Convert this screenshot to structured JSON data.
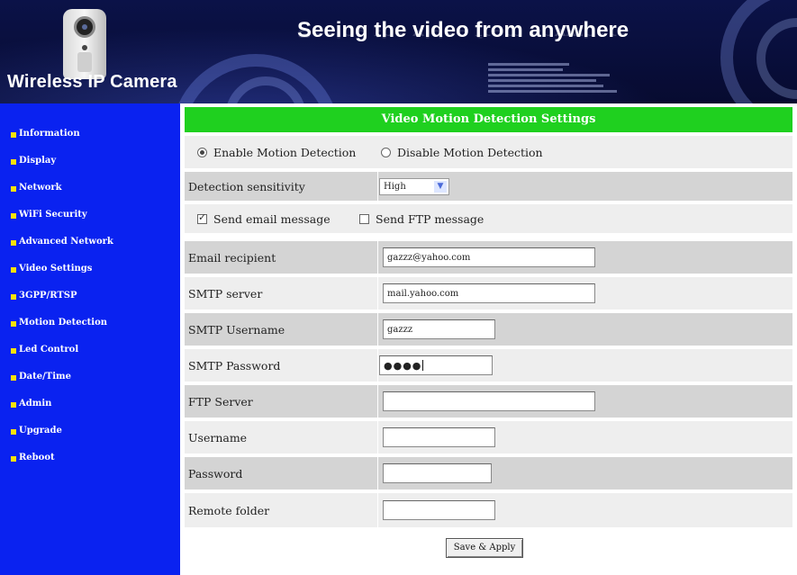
{
  "header": {
    "logo_text": "Wireless IP Camera",
    "slogan": "Seeing the video from anywhere"
  },
  "sidebar": {
    "items": [
      {
        "label": "Information"
      },
      {
        "label": "Display"
      },
      {
        "label": "Network"
      },
      {
        "label": "WiFi Security"
      },
      {
        "label": "Advanced Network"
      },
      {
        "label": "Video Settings"
      },
      {
        "label": "3GPP/RTSP"
      },
      {
        "label": "Motion Detection"
      },
      {
        "label": "Led Control"
      },
      {
        "label": "Date/Time"
      },
      {
        "label": "Admin"
      },
      {
        "label": "Upgrade"
      },
      {
        "label": "Reboot"
      }
    ]
  },
  "form": {
    "title": "Video Motion Detection Settings",
    "enable_label": "Enable Motion Detection",
    "disable_label": "Disable Motion Detection",
    "motion_enabled": true,
    "sensitivity_label": "Detection sensitivity",
    "sensitivity_value": "High",
    "send_email_label": "Send email message",
    "send_email_checked": true,
    "send_ftp_label": "Send FTP message",
    "send_ftp_checked": false,
    "email_recipient_label": "Email recipient",
    "email_recipient_value": "gazzz@yahoo.com",
    "smtp_server_label": "SMTP server",
    "smtp_server_value": "mail.yahoo.com",
    "smtp_username_label": "SMTP Username",
    "smtp_username_value": "gazzz",
    "smtp_password_label": "SMTP Password",
    "smtp_password_value": "●●●●",
    "ftp_server_label": "FTP Server",
    "ftp_server_value": "",
    "username_label": "Username",
    "username_value": "",
    "password_label": "Password",
    "password_value": "",
    "remote_folder_label": "Remote folder",
    "remote_folder_value": "",
    "save_label": "Save & Apply"
  },
  "colors": {
    "sidebar_bg": "#0a22f0",
    "sidebar_bullet": "#ffe200",
    "title_bar": "#1fd01f",
    "row_light": "#eeeeee",
    "row_dark": "#d4d4d4",
    "header_bg": "#0a0f3c"
  }
}
